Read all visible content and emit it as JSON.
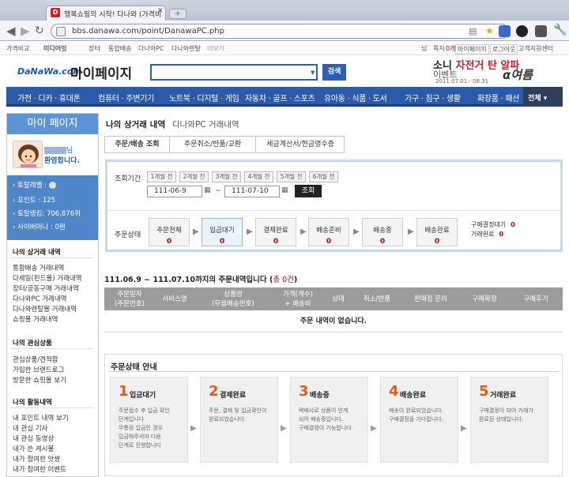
{
  "browser": {
    "tab_title": "행복쇼핑의 시작! 다나와 (가격비",
    "favicon_letter": "D",
    "url": "bbs.danawa.com/point/DanawaPC.php",
    "wrench_icon": "wrench-icon"
  },
  "util_bar": {
    "items": [
      "가격비교",
      "미디어잇",
      "장터",
      "통합배송",
      "다나와PC",
      "다나와렌탈",
      "더보기"
    ],
    "right_items": [
      "님",
      "쪽지",
      "0개",
      "마이페이지",
      "로그아웃",
      "고객지원센터"
    ]
  },
  "header": {
    "logo": "DaNaWa.com",
    "page_title": "마이페이지",
    "search_placeholder": "",
    "search_button": "검색",
    "ad": {
      "line1a": "소니 ",
      "line1b": "자전거 탄 알파",
      "line2": "이벤트",
      "date": "2011.07.01 - 08.31",
      "brand": "α여름"
    }
  },
  "main_nav": {
    "items": [
      "가전 · 디카 · 휴대폰",
      "컴퓨터 · 주변기기",
      "노트북 · 디지털 · 게임",
      "자동차 · 골프 · 스포츠",
      "유아동 · 식품 · 도서",
      "가구 · 침구 · 생활",
      "화장품 · 패션"
    ],
    "all_label": "전체"
  },
  "sidebar": {
    "title": "마이 페이지",
    "user_name": "님",
    "welcome": "환영합니다.",
    "stats": [
      "토탈레벨 :",
      "포인트 : 125",
      "토탈랭킹: 706,876위",
      "사이버머니 : 0원"
    ],
    "sections": [
      {
        "title": "나의 상거래 내역",
        "links": [
          "통합배송 거래내역",
          "다세일(핀드몰) 거래내역",
          "장터/공동구매 거래내역",
          "다나와PC 거래내역",
          "다나와렌탈몰 거래내역",
          "쇼핑몰 거래내역"
        ]
      },
      {
        "title": "나의 관심상품",
        "links": [
          "관심상품/견적함",
          "가입한 브랜드로그",
          "방문한 쇼핑몰 보기"
        ]
      },
      {
        "title": "나의 활동내역",
        "links": [
          "내 포인트 내역 보기",
          "내 관심 기사",
          "내 관심 동영상",
          "내가 쓴 게시물",
          "내가 참여한 앗쌍",
          "내가 참여한 이벤트"
        ]
      }
    ]
  },
  "breadcrumb": {
    "section": "나의 상거래 내역",
    "current": "다나와PC 거래내역"
  },
  "tabs": [
    "주문/배송 조회",
    "주문취소/반품/교환",
    "세금계산서/현금영수증"
  ],
  "filter": {
    "period_label": "조회기간",
    "period_buttons": [
      "1개월 전",
      "2개월 전",
      "3개월 전",
      "4개월 전",
      "5개월 전",
      "6개월 전"
    ],
    "date_from": "111-06-9",
    "date_to": "111-07-10",
    "tilde": "~",
    "search_button": "조회",
    "status_label": "주문상태",
    "statuses": [
      {
        "label": "주문전체",
        "count": "0"
      },
      {
        "label": "입금대기",
        "count": "0"
      },
      {
        "label": "결제완료",
        "count": "0"
      },
      {
        "label": "배송준비",
        "count": "0"
      },
      {
        "label": "배송중",
        "count": "0"
      },
      {
        "label": "배송완료",
        "count": "0"
      }
    ],
    "extra_statuses": [
      {
        "label": "구매결정대기",
        "count": "0"
      },
      {
        "label": "거래완료",
        "count": "0"
      }
    ]
  },
  "summary": {
    "text": "111.06.9 ~ 111.07.10까지의 주문내역입니다 (",
    "count": "총 0건",
    "close": ")"
  },
  "table": {
    "headers": [
      "주문일자\n(주문번호)",
      "서비스명",
      "상품명\n(무음배송번호)",
      "가격(개수)\n+ 배송비",
      "상태",
      "취소/반품",
      "판매점 문의",
      "구매확정",
      "구매후기"
    ],
    "empty_message": "주문 내역이 없습니다."
  },
  "guide": {
    "title": "주문상태 안내",
    "steps": [
      {
        "num": "1",
        "name": "입금대기",
        "desc": [
          "주문접수 후 입금 확인",
          "단계입니다",
          "무통장 입금인 경우",
          "입금해주셔야 다음",
          "단계로 진행합니다"
        ]
      },
      {
        "num": "2",
        "name": "결제완료",
        "desc": [
          "주문, 결제 및 입금확인이",
          "완료되었습니다."
        ]
      },
      {
        "num": "3",
        "name": "배송중",
        "desc": [
          "택배사로 상품이 인계",
          "되어 배송중입니다.",
          "구매결정이 가능합니다."
        ]
      },
      {
        "num": "4",
        "name": "배송완료",
        "desc": [
          "배송이 완료되었습니다.",
          "구매결정을 기다립니다."
        ]
      },
      {
        "num": "5",
        "name": "거래완료",
        "desc": [
          "구매결정이 되어 거래가",
          "완료된 상태입니다."
        ]
      }
    ]
  },
  "colors": {
    "brand_blue": "#2b5ba8",
    "sidebar_blue": "#4e86c7",
    "accent_red": "#cc0000",
    "step_orange": "#e55a12"
  }
}
